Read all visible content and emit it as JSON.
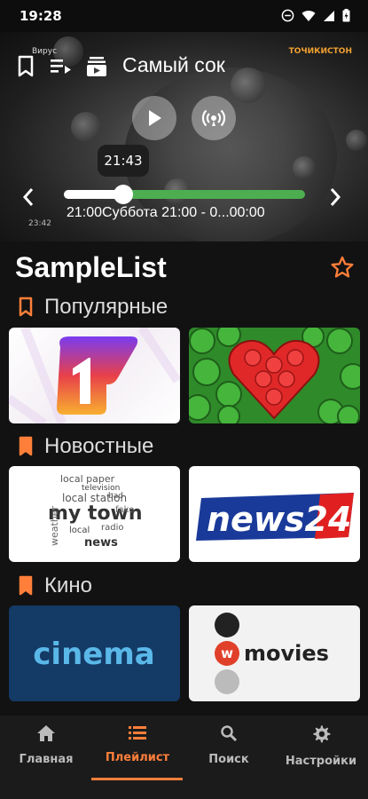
{
  "status": {
    "time": "19:28"
  },
  "player": {
    "title": "Самый сок",
    "overlay_label": "Вирус",
    "channel_logo_text": "ТОЧИКИСТОН",
    "tooltip_time": "21:43",
    "progress_text": "21:00Суббота 21:00 - 0...00:00",
    "small_time": "23:42",
    "progress_fraction": 0.25,
    "colors": {
      "played": "#ffffff",
      "remaining": "#4cae50"
    }
  },
  "playlist": {
    "name": "SampleList",
    "sections": [
      {
        "label": "Популярные"
      },
      {
        "label": "Новостные"
      },
      {
        "label": "Кино"
      }
    ],
    "cards": {
      "news24": "news24",
      "cinema": "cinema",
      "movies": "movies",
      "wordcloud": [
        "local paper",
        "television",
        "my town",
        "local station",
        "weather",
        "radio",
        "local",
        "news",
        "fake",
        "bad"
      ]
    }
  },
  "nav": {
    "items": [
      {
        "label": "Главная",
        "icon": "home-icon"
      },
      {
        "label": "Плейлист",
        "icon": "list-icon"
      },
      {
        "label": "Поиск",
        "icon": "search-icon"
      },
      {
        "label": "Настройки",
        "icon": "gear-icon"
      }
    ],
    "active_index": 1,
    "accent": "#ff7f3a"
  }
}
